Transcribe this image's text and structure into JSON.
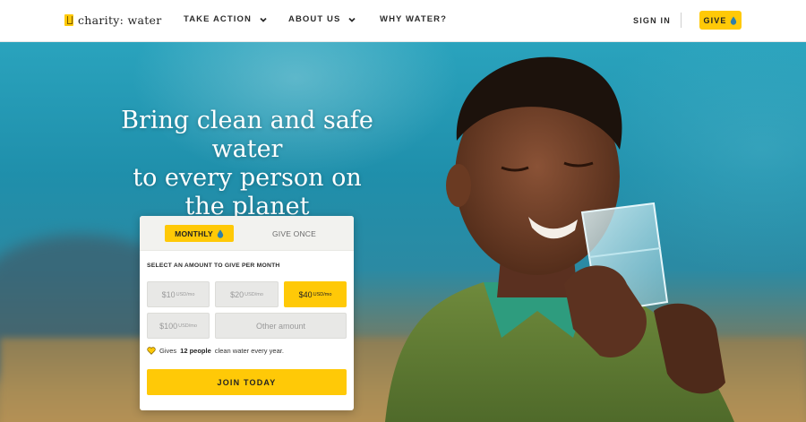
{
  "header": {
    "logo_text": "charity: water",
    "nav": [
      {
        "label": "TAKE ACTION",
        "has_dropdown": true
      },
      {
        "label": "ABOUT US",
        "has_dropdown": true
      },
      {
        "label": "WHY WATER?",
        "has_dropdown": false
      }
    ],
    "sign_in": "SIGN IN",
    "give": "GIVE"
  },
  "hero": {
    "headline_line1": "Bring clean and safe water",
    "headline_line2": "to every person on",
    "headline_line3": "the planet"
  },
  "donation": {
    "tabs": [
      {
        "label": "MONTHLY",
        "active": true
      },
      {
        "label": "GIVE ONCE",
        "active": false
      }
    ],
    "instruction": "SELECT AN AMOUNT TO GIVE PER MONTH",
    "amounts": [
      {
        "value": "$10",
        "unit": "USD/mo",
        "selected": false
      },
      {
        "value": "$20",
        "unit": "USD/mo",
        "selected": false
      },
      {
        "value": "$40",
        "unit": "USD/mo",
        "selected": true
      },
      {
        "value": "$100",
        "unit": "USD/mo",
        "selected": false
      }
    ],
    "other_amount": "Other amount",
    "impact_prefix": "Gives",
    "impact_count": "12 people",
    "impact_suffix": "clean water every year.",
    "join": "JOIN TODAY"
  },
  "colors": {
    "accent": "#ffc907",
    "sky": "#1f8fab"
  },
  "icons": [
    "chevron-down-icon",
    "water-drop-icon",
    "heart-icon",
    "logo-jerrycan-icon"
  ]
}
